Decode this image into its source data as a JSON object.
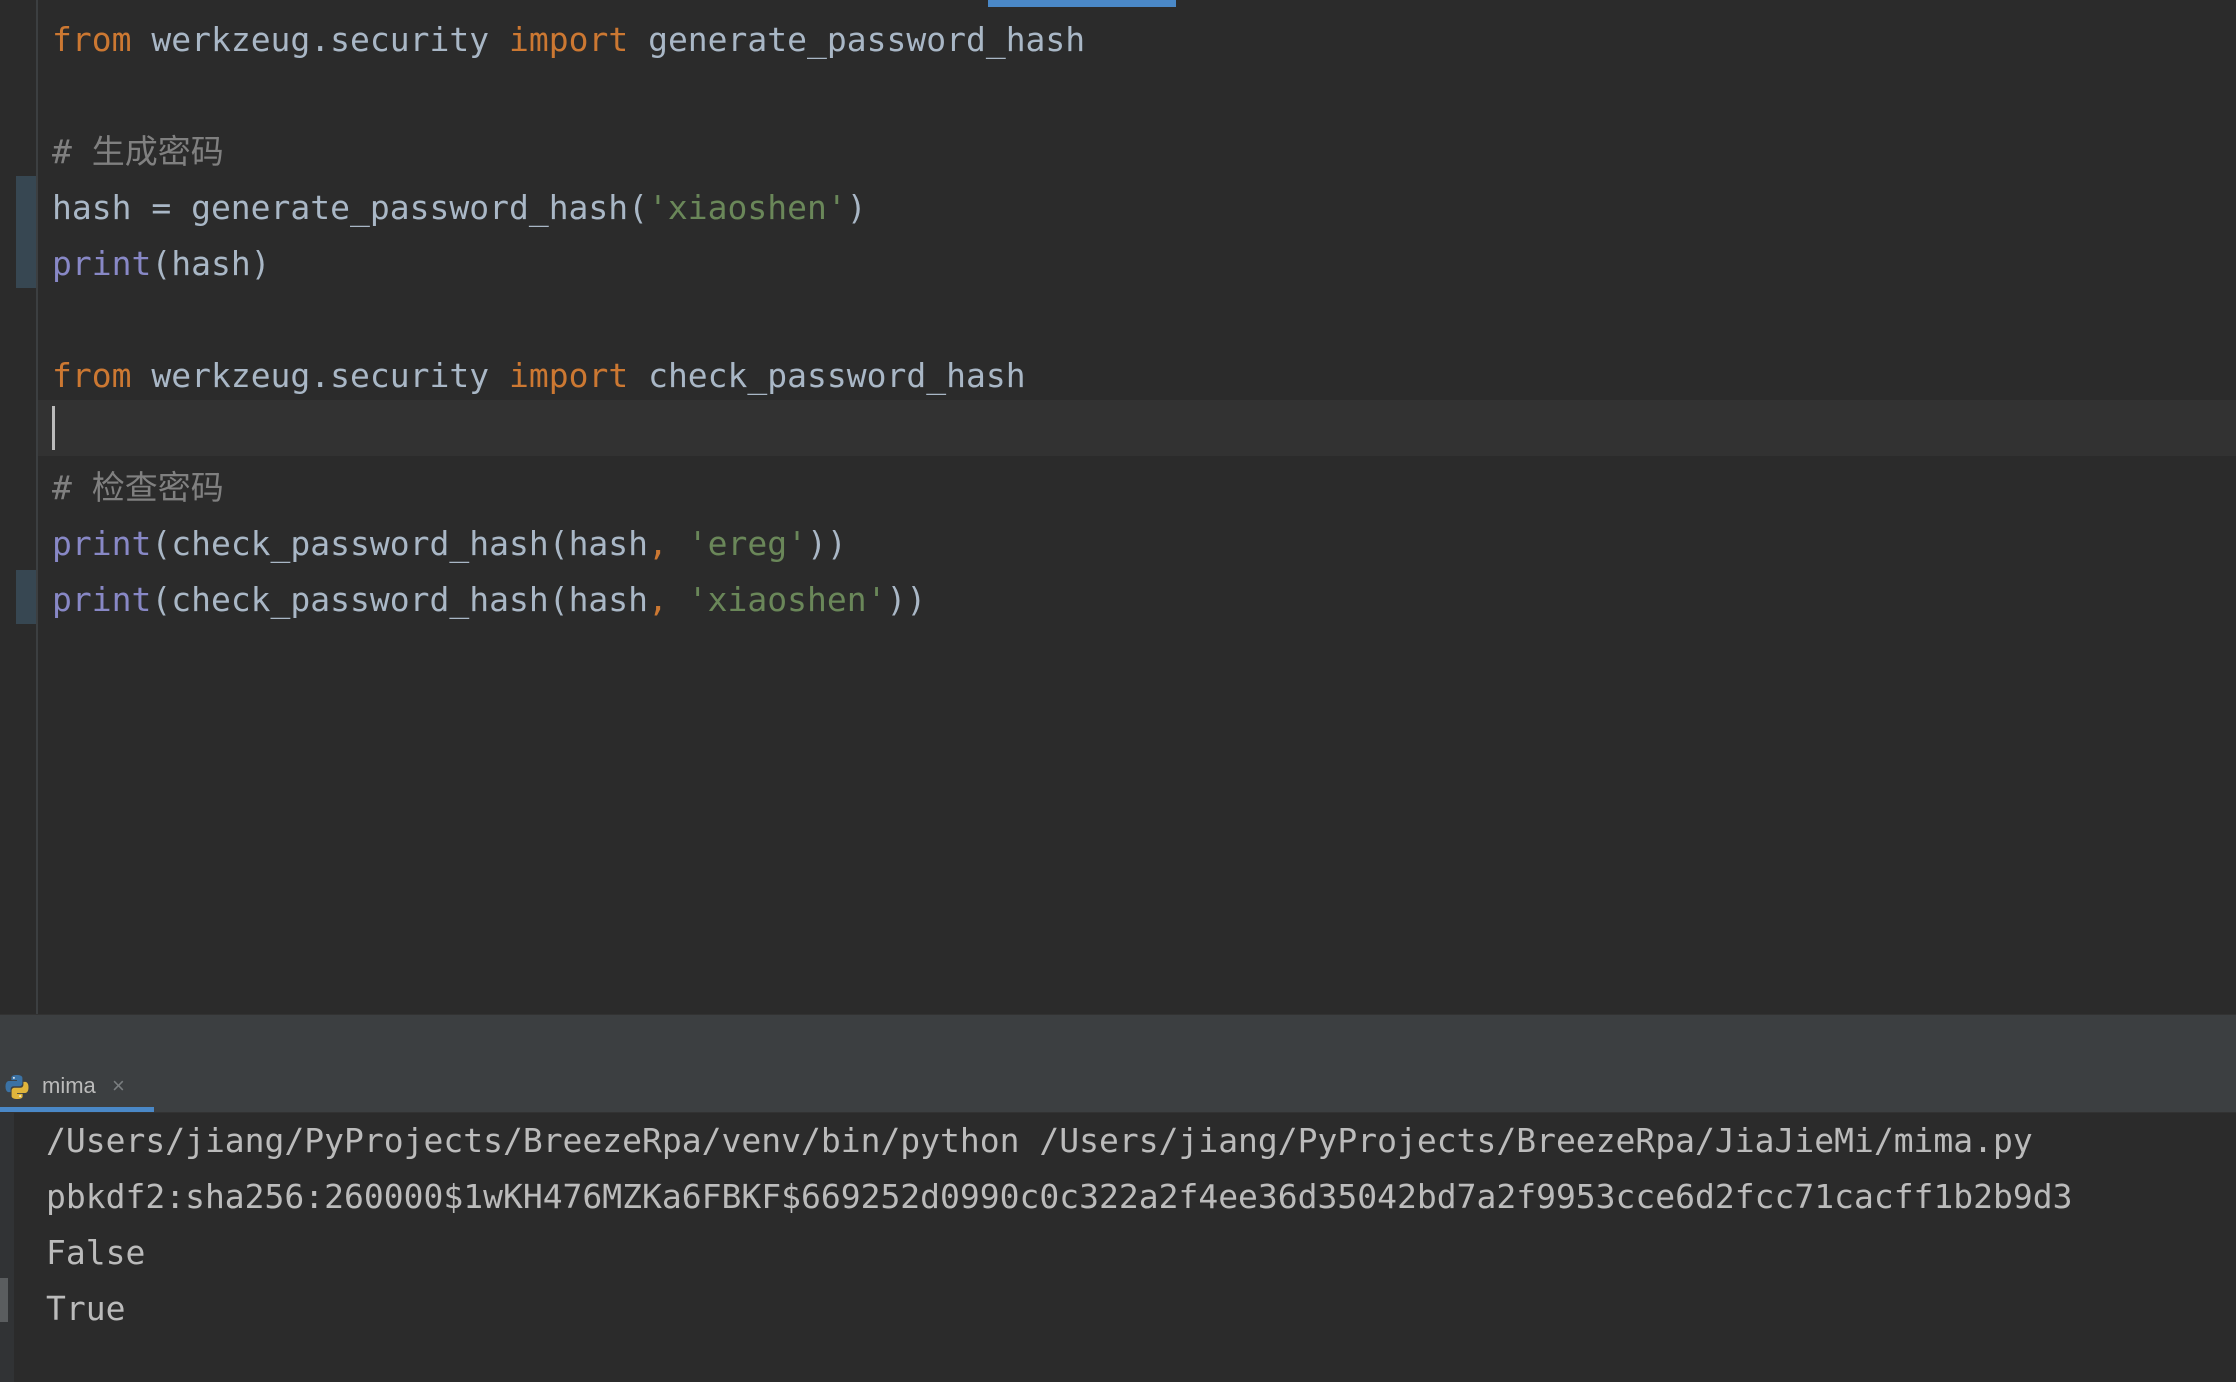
{
  "editor": {
    "lines": {
      "l1": {
        "kw_from": "from",
        "module": " werkzeug.security ",
        "kw_import": "import",
        "name": " generate_password_hash"
      },
      "l3": {
        "comment": "# 生成密码"
      },
      "l4": {
        "pre": "hash = generate_password_hash(",
        "str": "'xiaoshen'",
        "post": ")"
      },
      "l5": {
        "builtin": "print",
        "rest": "(hash)"
      },
      "l7": {
        "kw_from": "from",
        "module": " werkzeug.security ",
        "kw_import": "import",
        "name": " check_password_hash"
      },
      "l9": {
        "comment": "# 检查密码"
      },
      "l10": {
        "builtin": "print",
        "pre": "(check_password_hash(hash",
        "comma": ",",
        "space": " ",
        "str": "'ereg'",
        "post": "))"
      },
      "l11": {
        "builtin": "print",
        "pre": "(check_password_hash(hash",
        "comma": ",",
        "space": " ",
        "str": "'xiaoshen'",
        "post": "))"
      }
    }
  },
  "run_panel": {
    "tab": {
      "label": "mima",
      "close": "×",
      "icon": "python-icon"
    },
    "output": [
      "/Users/jiang/PyProjects/BreezeRpa/venv/bin/python /Users/jiang/PyProjects/BreezeRpa/JiaJieMi/mima.py",
      "pbkdf2:sha256:260000$1wKH476MZKa6FBKF$669252d0990c0c322a2f4ee36d35042bd7a2f9953cce6d2fcc71cacff1b2b9d3",
      "False",
      "True"
    ]
  },
  "colors": {
    "background": "#2b2b2b",
    "keyword": "#cc7832",
    "string": "#6a8759",
    "builtin": "#8888c6",
    "comment": "#808080",
    "text": "#a9b7c6",
    "accent": "#4a88c7"
  }
}
